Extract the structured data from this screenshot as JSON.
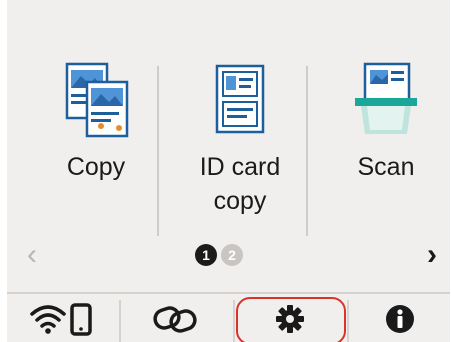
{
  "tiles": [
    {
      "label": "Copy",
      "icon": "copy-icon"
    },
    {
      "label": "ID card\ncopy",
      "icon": "id-card-copy-icon"
    },
    {
      "label": "Scan",
      "icon": "scan-icon"
    }
  ],
  "pager": {
    "page1": "1",
    "page2": "2",
    "current": 1
  },
  "nav": {
    "prev": "‹",
    "next": "›"
  },
  "bottom_bar": {
    "icons": [
      "wifi-phone-icon",
      "connect-icon",
      "settings-icon",
      "info-icon"
    ],
    "highlighted": "settings-icon"
  },
  "colors": {
    "background": "#f1efed",
    "highlight": "#d9342b",
    "accent_blue": "#2f7fc9",
    "accent_teal": "#1aa79a"
  }
}
